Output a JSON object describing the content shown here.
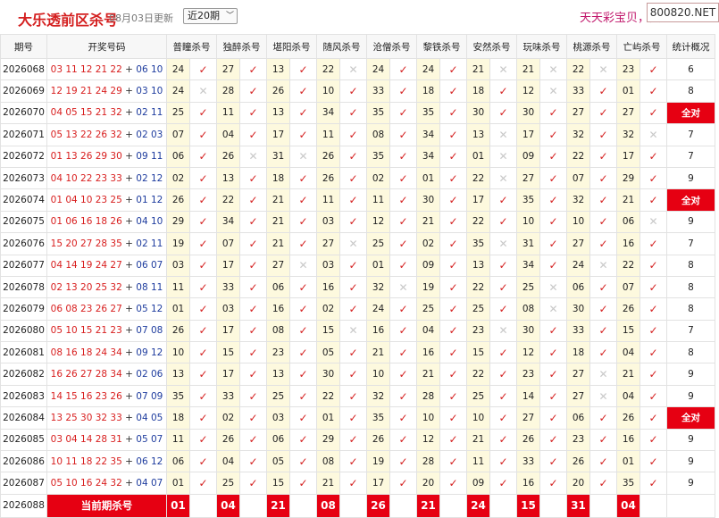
{
  "header": {
    "title": "大乐透前区杀号",
    "date": "08月03日更新",
    "select_value": "近20期",
    "ad_text": "天天彩宝贝，天",
    "watermark": "800820.NET"
  },
  "columns": [
    "期号",
    "开奖号码",
    "普瞳杀号",
    "独醉杀号",
    "堪阳杀号",
    "随风杀号",
    "沧僧杀号",
    "黎铁杀号",
    "安然杀号",
    "玩味杀号",
    "桃源杀号",
    "亡屿杀号",
    "统计概况"
  ],
  "rows": [
    {
      "issue": "2026068",
      "front": "03 11 12 21 22",
      "back": "06 10",
      "kills": [
        [
          "24",
          "y"
        ],
        [
          "27",
          "y"
        ],
        [
          "13",
          "y"
        ],
        [
          "22",
          "x"
        ],
        [
          "24",
          "y"
        ],
        [
          "24",
          "y"
        ],
        [
          "21",
          "x"
        ],
        [
          "21",
          "x"
        ],
        [
          "22",
          "x"
        ],
        [
          "23",
          "y"
        ]
      ],
      "summary": "6"
    },
    {
      "issue": "2026069",
      "front": "12 19 21 24 29",
      "back": "03 10",
      "kills": [
        [
          "24",
          "x"
        ],
        [
          "28",
          "y"
        ],
        [
          "26",
          "y"
        ],
        [
          "10",
          "y"
        ],
        [
          "33",
          "y"
        ],
        [
          "18",
          "y"
        ],
        [
          "18",
          "y"
        ],
        [
          "12",
          "x"
        ],
        [
          "33",
          "y"
        ],
        [
          "01",
          "y"
        ]
      ],
      "summary": "8"
    },
    {
      "issue": "2026070",
      "front": "04 05 15 21 32",
      "back": "02 11",
      "kills": [
        [
          "25",
          "y"
        ],
        [
          "11",
          "y"
        ],
        [
          "13",
          "y"
        ],
        [
          "34",
          "y"
        ],
        [
          "35",
          "y"
        ],
        [
          "35",
          "y"
        ],
        [
          "30",
          "y"
        ],
        [
          "30",
          "y"
        ],
        [
          "27",
          "y"
        ],
        [
          "27",
          "y"
        ]
      ],
      "summary": "全对"
    },
    {
      "issue": "2026071",
      "front": "05 13 22 26 32",
      "back": "02 03",
      "kills": [
        [
          "07",
          "y"
        ],
        [
          "04",
          "y"
        ],
        [
          "17",
          "y"
        ],
        [
          "11",
          "y"
        ],
        [
          "08",
          "y"
        ],
        [
          "34",
          "y"
        ],
        [
          "13",
          "x"
        ],
        [
          "17",
          "y"
        ],
        [
          "32",
          "y"
        ],
        [
          "32",
          "x"
        ]
      ],
      "summary": "7"
    },
    {
      "issue": "2026072",
      "front": "01 13 26 29 30",
      "back": "09 11",
      "kills": [
        [
          "06",
          "y"
        ],
        [
          "26",
          "x"
        ],
        [
          "31",
          "x"
        ],
        [
          "26",
          "y"
        ],
        [
          "35",
          "y"
        ],
        [
          "34",
          "y"
        ],
        [
          "01",
          "x"
        ],
        [
          "09",
          "y"
        ],
        [
          "22",
          "y"
        ],
        [
          "17",
          "y"
        ]
      ],
      "summary": "7"
    },
    {
      "issue": "2026073",
      "front": "04 10 22 23 33",
      "back": "02 12",
      "kills": [
        [
          "02",
          "y"
        ],
        [
          "13",
          "y"
        ],
        [
          "18",
          "y"
        ],
        [
          "26",
          "y"
        ],
        [
          "02",
          "y"
        ],
        [
          "01",
          "y"
        ],
        [
          "22",
          "x"
        ],
        [
          "27",
          "y"
        ],
        [
          "07",
          "y"
        ],
        [
          "29",
          "y"
        ]
      ],
      "summary": "9"
    },
    {
      "issue": "2026074",
      "front": "01 04 10 23 25",
      "back": "01 12",
      "kills": [
        [
          "26",
          "y"
        ],
        [
          "22",
          "y"
        ],
        [
          "21",
          "y"
        ],
        [
          "11",
          "y"
        ],
        [
          "11",
          "y"
        ],
        [
          "30",
          "y"
        ],
        [
          "17",
          "y"
        ],
        [
          "35",
          "y"
        ],
        [
          "32",
          "y"
        ],
        [
          "21",
          "y"
        ]
      ],
      "summary": "全对"
    },
    {
      "issue": "2026075",
      "front": "01 06 16 18 26",
      "back": "04 10",
      "kills": [
        [
          "29",
          "y"
        ],
        [
          "34",
          "y"
        ],
        [
          "21",
          "y"
        ],
        [
          "03",
          "y"
        ],
        [
          "12",
          "y"
        ],
        [
          "21",
          "y"
        ],
        [
          "22",
          "y"
        ],
        [
          "10",
          "y"
        ],
        [
          "10",
          "y"
        ],
        [
          "06",
          "x"
        ]
      ],
      "summary": "9"
    },
    {
      "issue": "2026076",
      "front": "15 20 27 28 35",
      "back": "02 11",
      "kills": [
        [
          "19",
          "y"
        ],
        [
          "07",
          "y"
        ],
        [
          "21",
          "y"
        ],
        [
          "27",
          "x"
        ],
        [
          "25",
          "y"
        ],
        [
          "02",
          "y"
        ],
        [
          "35",
          "x"
        ],
        [
          "31",
          "y"
        ],
        [
          "27",
          "y"
        ],
        [
          "16",
          "y"
        ]
      ],
      "summary": "7"
    },
    {
      "issue": "2026077",
      "front": "04 14 19 24 27",
      "back": "06 07",
      "kills": [
        [
          "03",
          "y"
        ],
        [
          "17",
          "y"
        ],
        [
          "27",
          "x"
        ],
        [
          "03",
          "y"
        ],
        [
          "01",
          "y"
        ],
        [
          "09",
          "y"
        ],
        [
          "13",
          "y"
        ],
        [
          "34",
          "y"
        ],
        [
          "24",
          "x"
        ],
        [
          "22",
          "y"
        ]
      ],
      "summary": "8"
    },
    {
      "issue": "2026078",
      "front": "02 13 20 25 32",
      "back": "08 11",
      "kills": [
        [
          "11",
          "y"
        ],
        [
          "33",
          "y"
        ],
        [
          "06",
          "y"
        ],
        [
          "16",
          "y"
        ],
        [
          "32",
          "x"
        ],
        [
          "19",
          "y"
        ],
        [
          "22",
          "y"
        ],
        [
          "25",
          "x"
        ],
        [
          "06",
          "y"
        ],
        [
          "07",
          "y"
        ]
      ],
      "summary": "8"
    },
    {
      "issue": "2026079",
      "front": "06 08 23 26 27",
      "back": "05 12",
      "kills": [
        [
          "01",
          "y"
        ],
        [
          "03",
          "y"
        ],
        [
          "16",
          "y"
        ],
        [
          "02",
          "y"
        ],
        [
          "24",
          "y"
        ],
        [
          "25",
          "y"
        ],
        [
          "25",
          "y"
        ],
        [
          "08",
          "x"
        ],
        [
          "30",
          "y"
        ],
        [
          "26",
          "y"
        ]
      ],
      "summary": "8"
    },
    {
      "issue": "2026080",
      "front": "05 10 15 21 23",
      "back": "07 08",
      "kills": [
        [
          "26",
          "y"
        ],
        [
          "17",
          "y"
        ],
        [
          "08",
          "y"
        ],
        [
          "15",
          "x"
        ],
        [
          "16",
          "y"
        ],
        [
          "04",
          "y"
        ],
        [
          "23",
          "x"
        ],
        [
          "30",
          "y"
        ],
        [
          "33",
          "y"
        ],
        [
          "15",
          "y"
        ]
      ],
      "summary": "7"
    },
    {
      "issue": "2026081",
      "front": "08 16 18 24 34",
      "back": "09 12",
      "kills": [
        [
          "10",
          "y"
        ],
        [
          "15",
          "y"
        ],
        [
          "23",
          "y"
        ],
        [
          "05",
          "y"
        ],
        [
          "21",
          "y"
        ],
        [
          "16",
          "y"
        ],
        [
          "15",
          "y"
        ],
        [
          "12",
          "y"
        ],
        [
          "18",
          "y"
        ],
        [
          "04",
          "y"
        ]
      ],
      "summary": "8"
    },
    {
      "issue": "2026082",
      "front": "16 26 27 28 34",
      "back": "02 06",
      "kills": [
        [
          "13",
          "y"
        ],
        [
          "17",
          "y"
        ],
        [
          "13",
          "y"
        ],
        [
          "30",
          "y"
        ],
        [
          "10",
          "y"
        ],
        [
          "21",
          "y"
        ],
        [
          "22",
          "y"
        ],
        [
          "23",
          "y"
        ],
        [
          "27",
          "x"
        ],
        [
          "21",
          "y"
        ]
      ],
      "summary": "9"
    },
    {
      "issue": "2026083",
      "front": "14 15 16 23 26",
      "back": "07 09",
      "kills": [
        [
          "35",
          "y"
        ],
        [
          "33",
          "y"
        ],
        [
          "25",
          "y"
        ],
        [
          "22",
          "y"
        ],
        [
          "32",
          "y"
        ],
        [
          "28",
          "y"
        ],
        [
          "25",
          "y"
        ],
        [
          "14",
          "y"
        ],
        [
          "27",
          "x"
        ],
        [
          "04",
          "y"
        ]
      ],
      "summary": "9"
    },
    {
      "issue": "2026084",
      "front": "13 25 30 32 33",
      "back": "04 05",
      "kills": [
        [
          "18",
          "y"
        ],
        [
          "02",
          "y"
        ],
        [
          "03",
          "y"
        ],
        [
          "01",
          "y"
        ],
        [
          "35",
          "y"
        ],
        [
          "10",
          "y"
        ],
        [
          "10",
          "y"
        ],
        [
          "27",
          "y"
        ],
        [
          "06",
          "y"
        ],
        [
          "26",
          "y"
        ]
      ],
      "summary": "全对"
    },
    {
      "issue": "2026085",
      "front": "03 04 14 28 31",
      "back": "05 07",
      "kills": [
        [
          "11",
          "y"
        ],
        [
          "26",
          "y"
        ],
        [
          "06",
          "y"
        ],
        [
          "29",
          "y"
        ],
        [
          "26",
          "y"
        ],
        [
          "12",
          "y"
        ],
        [
          "21",
          "y"
        ],
        [
          "26",
          "y"
        ],
        [
          "23",
          "y"
        ],
        [
          "16",
          "y"
        ]
      ],
      "summary": "9"
    },
    {
      "issue": "2026086",
      "front": "10 11 18 22 35",
      "back": "06 12",
      "kills": [
        [
          "06",
          "y"
        ],
        [
          "04",
          "y"
        ],
        [
          "05",
          "y"
        ],
        [
          "08",
          "y"
        ],
        [
          "19",
          "y"
        ],
        [
          "28",
          "y"
        ],
        [
          "11",
          "y"
        ],
        [
          "33",
          "y"
        ],
        [
          "26",
          "y"
        ],
        [
          "01",
          "y"
        ]
      ],
      "summary": "9"
    },
    {
      "issue": "2026087",
      "front": "05 10 16 24 32",
      "back": "04 07",
      "kills": [
        [
          "01",
          "y"
        ],
        [
          "25",
          "y"
        ],
        [
          "15",
          "y"
        ],
        [
          "21",
          "y"
        ],
        [
          "17",
          "y"
        ],
        [
          "20",
          "y"
        ],
        [
          "09",
          "y"
        ],
        [
          "16",
          "y"
        ],
        [
          "20",
          "y"
        ],
        [
          "35",
          "y"
        ]
      ],
      "summary": "9"
    }
  ],
  "current": {
    "issue": "2026088",
    "label": "当前期杀号",
    "kills": [
      "01",
      "04",
      "21",
      "08",
      "26",
      "21",
      "24",
      "15",
      "31",
      "04"
    ]
  },
  "marks": {
    "y": "✓",
    "x": "✕"
  },
  "colors": {
    "accent_red": "#e60012",
    "kill_bg": "#fdf9de",
    "back_blue": "#1e3c9e"
  }
}
